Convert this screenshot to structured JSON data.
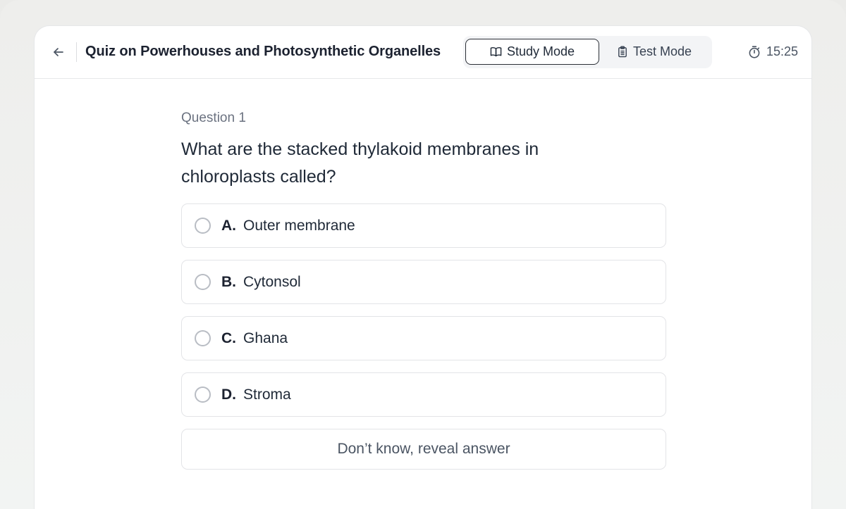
{
  "header": {
    "title": "Quiz on Powerhouses and Photosynthetic Organelles",
    "modes": [
      {
        "label": "Study Mode",
        "icon": "book-open-icon",
        "active": true
      },
      {
        "label": "Test Mode",
        "icon": "clipboard-icon",
        "active": false
      }
    ],
    "timer": "15:25"
  },
  "question": {
    "label": "Question 1",
    "text": "What are the stacked thylakoid membranes in chloroplasts called?",
    "options": [
      {
        "letter": "A.",
        "text": "Outer membrane"
      },
      {
        "letter": "B.",
        "text": "Cytonsol"
      },
      {
        "letter": "C.",
        "text": "Ghana"
      },
      {
        "letter": "D.",
        "text": "Stroma"
      }
    ],
    "reveal_label": "Don’t know, reveal answer"
  }
}
